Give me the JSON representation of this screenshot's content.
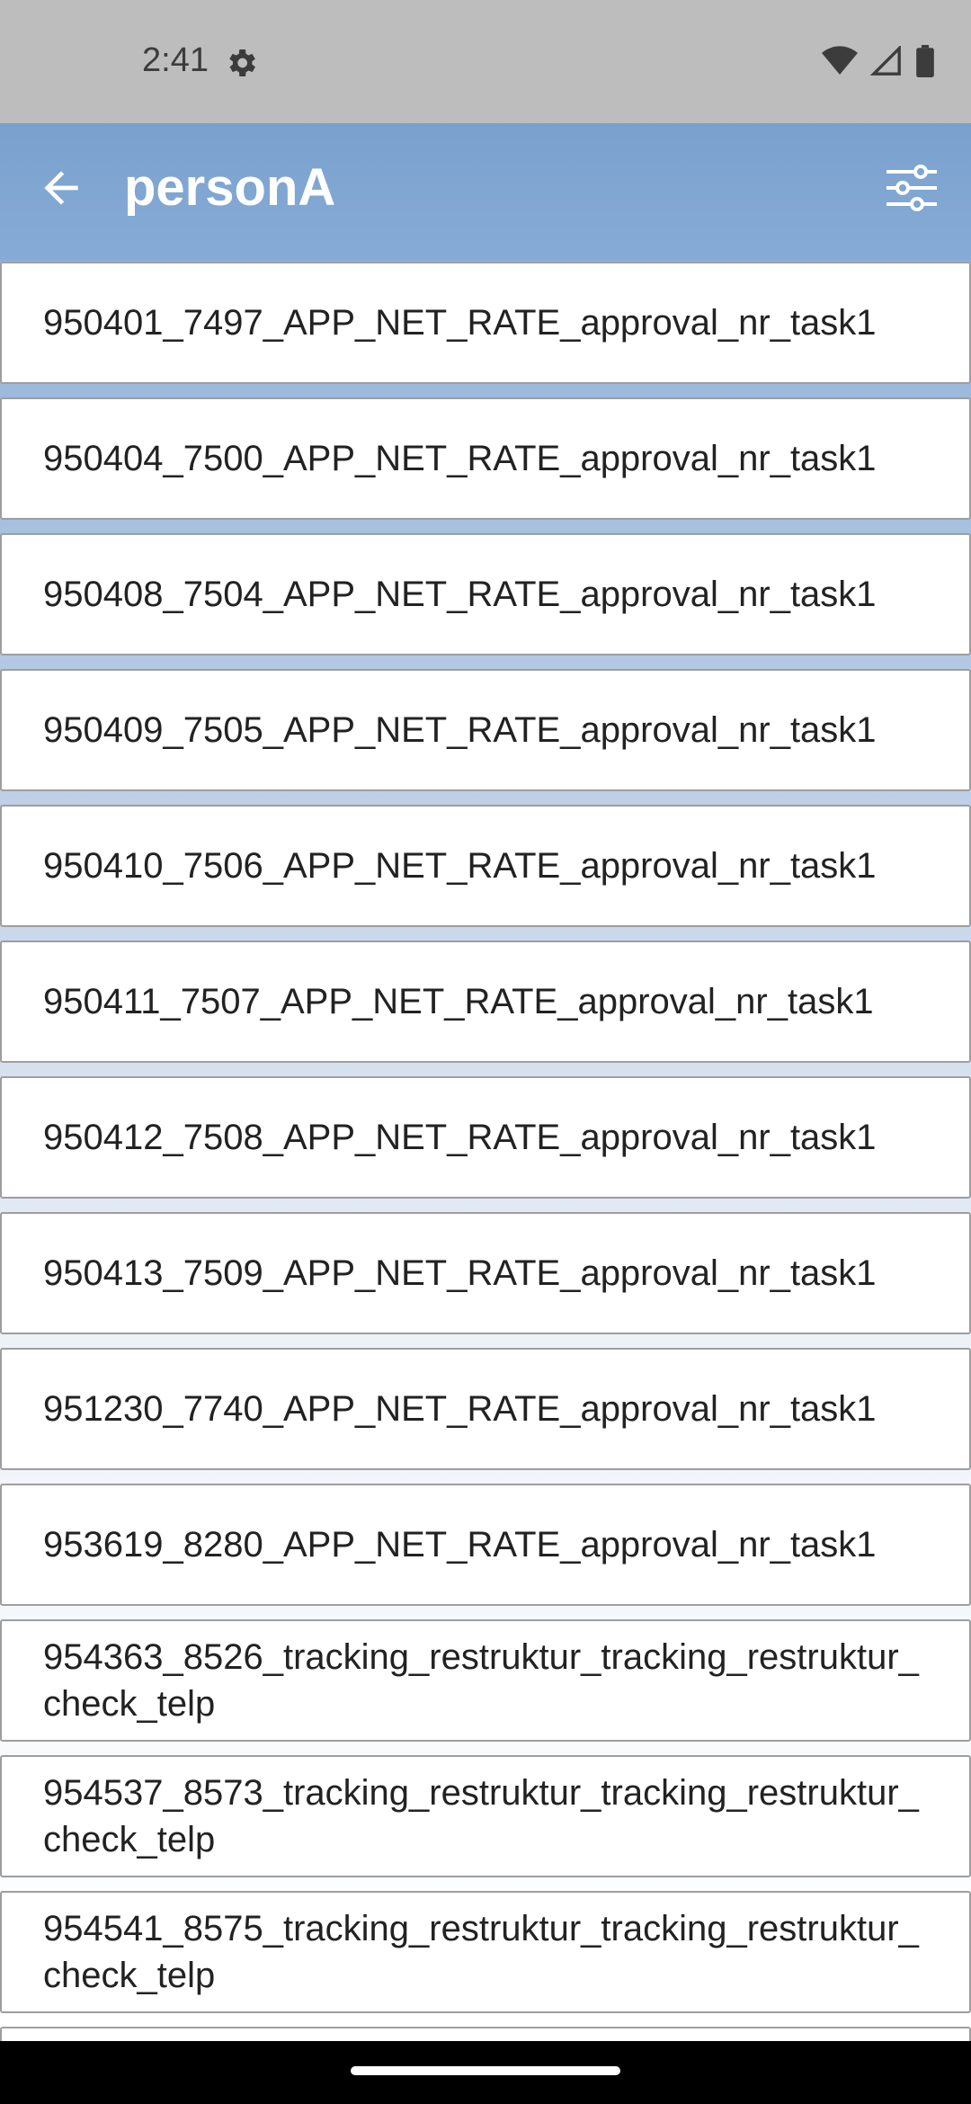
{
  "status_bar": {
    "time": "2:41",
    "icons": [
      "settings-gear-icon",
      "wifi-icon",
      "cellular-signal-icon",
      "battery-icon"
    ]
  },
  "app_bar": {
    "title": "personA",
    "back_icon": "arrow-back-icon",
    "filter_icon": "tune-sliders-icon"
  },
  "colors": {
    "app_bar": "#7aa1cd",
    "status_bar": "#bdbdbd",
    "item_border": "#9e9e9e",
    "text": "#222222"
  },
  "tasks": [
    "950401_7497_APP_NET_RATE_approval_nr_task1",
    "950404_7500_APP_NET_RATE_approval_nr_task1",
    "950408_7504_APP_NET_RATE_approval_nr_task1",
    "950409_7505_APP_NET_RATE_approval_nr_task1",
    "950410_7506_APP_NET_RATE_approval_nr_task1",
    "950411_7507_APP_NET_RATE_approval_nr_task1",
    "950412_7508_APP_NET_RATE_approval_nr_task1",
    "950413_7509_APP_NET_RATE_approval_nr_task1",
    "951230_7740_APP_NET_RATE_approval_nr_task1",
    "953619_8280_APP_NET_RATE_approval_nr_task1",
    "954363_8526_tracking_restruktur_tracking_restruktur_check_telp",
    "954537_8573_tracking_restruktur_tracking_restruktur_check_telp",
    "954541_8575_tracking_restruktur_tracking_restruktur_check_telp",
    ""
  ]
}
